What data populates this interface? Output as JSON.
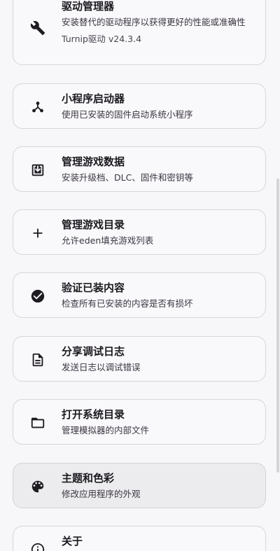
{
  "items": [
    {
      "title": "驱动管理器",
      "subtitle": "安装替代的驱动程序以获得更好的性能或准确性",
      "version": "Turnip驱动  v24.3.4",
      "icon": "wrench-icon"
    },
    {
      "title": "小程序启动器",
      "subtitle": "使用已安装的固件启动系统小程序",
      "icon": "applet-share-icon"
    },
    {
      "title": "管理游戏数据",
      "subtitle": "安装升级档、DLC、固件和密钥等",
      "icon": "download-box-icon"
    },
    {
      "title": "管理游戏目录",
      "subtitle": "允许eden填充游戏列表",
      "icon": "plus-icon"
    },
    {
      "title": "验证已装内容",
      "subtitle": "检查所有已安装的内容是否有损坏",
      "icon": "check-circle-icon"
    },
    {
      "title": "分享调试日志",
      "subtitle": "发送日志以调试错误",
      "icon": "document-icon"
    },
    {
      "title": "打开系统目录",
      "subtitle": "管理模拟器的内部文件",
      "icon": "folder-open-icon"
    },
    {
      "title": "主题和色彩",
      "subtitle": "修改应用程序的外观",
      "icon": "palette-icon"
    },
    {
      "title": "关于",
      "subtitle": "",
      "icon": "info-icon"
    }
  ]
}
